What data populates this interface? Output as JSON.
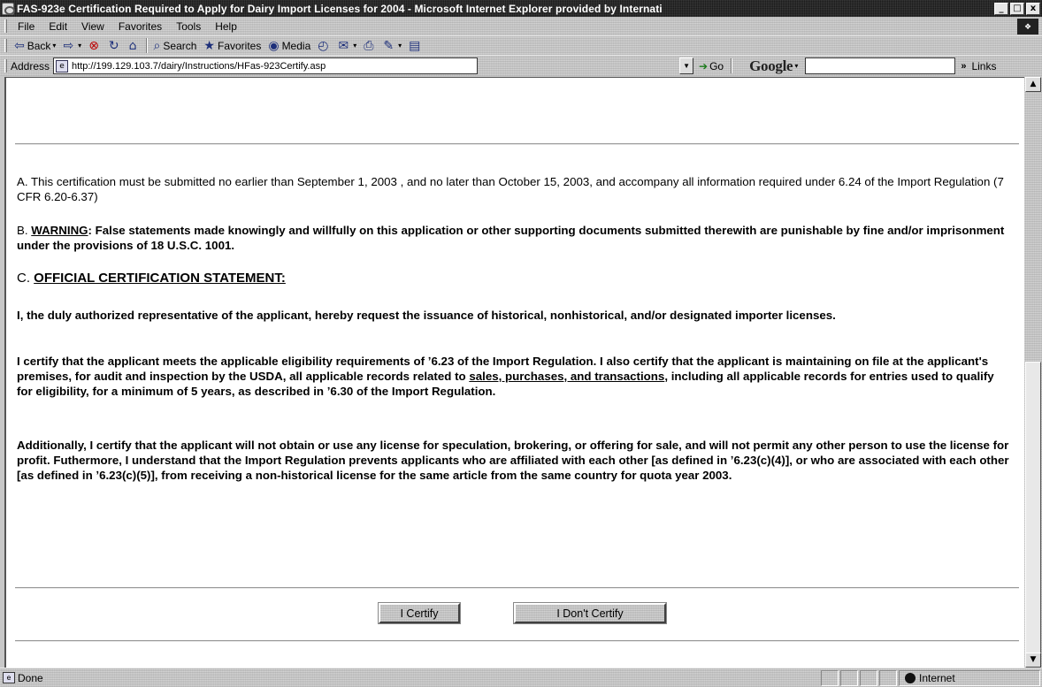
{
  "window": {
    "title": "FAS-923e Certification Required to Apply for Dairy Import Licenses for 2004 - Microsoft Internet Explorer provided by Internati",
    "minimize": "_",
    "maximize": "□",
    "close": "x"
  },
  "menu": {
    "items": [
      "File",
      "Edit",
      "View",
      "Favorites",
      "Tools",
      "Help"
    ]
  },
  "toolbar": {
    "back": "Back",
    "search": "Search",
    "favorites": "Favorites",
    "media": "Media"
  },
  "address": {
    "label": "Address",
    "url": "http://199.129.103.7/dairy/Instructions/HFas-923Certify.asp",
    "go": "Go",
    "google": "Google",
    "google_drop": "▾",
    "chevron": "»",
    "links": "Links"
  },
  "content": {
    "para_a": "A. This certification must be submitted no earlier than September 1, 2003 , and no later than October 15, 2003, and accompany all information required under 6.24 of the Import Regulation (7 CFR 6.20-6.37)",
    "para_b_prefix": "B. ",
    "para_b_warning": "WARNING",
    "para_b_text": ": False statements made knowingly and willfully on this application or other supporting documents submitted therewith are punishable by fine and/or imprisonment under the provisions of 18 U.S.C. 1001.",
    "para_c_prefix": "C. ",
    "para_c_heading": "OFFICIAL CERTIFICATION STATEMENT:",
    "para_1": "I, the duly authorized representative of the applicant, hereby request the issuance of historical, nonhistorical, and/or designated importer licenses.",
    "para_2_start": "I certify that the applicant meets the applicable eligibility requirements of ʼ6.23 of the Import Regulation. I also certify that the applicant is maintaining on file at the applicant's premises, for audit and inspection by the USDA, all applicable records related to ",
    "para_2_link": "sales, purchases, and transactions",
    "para_2_end": ", including all applicable records for entries used to qualify for eligibility, for a minimum of 5 years, as described in ʼ6.30 of the Import Regulation.",
    "para_3": "Additionally, I certify that the applicant will not obtain or use any license for speculation, brokering, or offering for sale, and will not permit any other person to use the license for profit. Futhermore, I understand that the Import Regulation prevents applicants who are affiliated with each other [as defined in ʼ6.23(c)(4)], or who are associated with each other [as defined in ʼ6.23(c)(5)], from receiving a non-historical license for the same article from the same country for quota year 2003."
  },
  "buttons": {
    "certify": "I Certify",
    "dont_certify": "I Don't Certify"
  },
  "status": {
    "text": "Done",
    "zone": "Internet"
  }
}
